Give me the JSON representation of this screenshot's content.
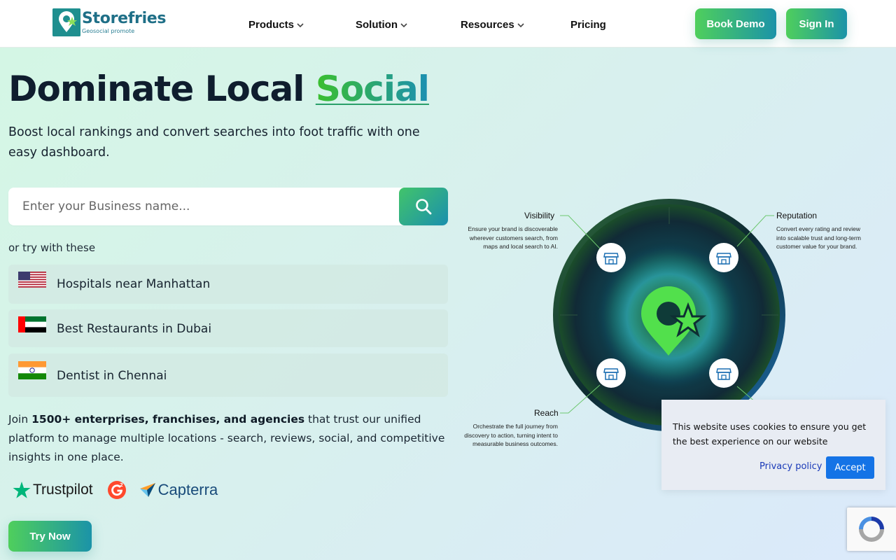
{
  "brand": {
    "name": "Storefries",
    "tagline": "Geosocial promote"
  },
  "nav": {
    "items": [
      {
        "label": "Products"
      },
      {
        "label": "Solution"
      },
      {
        "label": "Resources"
      },
      {
        "label": "Pricing"
      }
    ],
    "book_demo": "Book Demo",
    "sign_in": "Sign In"
  },
  "hero": {
    "title_main": "Dominate Local",
    "title_accent": "Social",
    "subtitle": "Boost local rankings and convert searches into foot traffic with one easy dashboard."
  },
  "search": {
    "placeholder": "Enter your Business name..."
  },
  "suggestions": {
    "label": "or try with these",
    "items": [
      {
        "label": "Hospitals near Manhattan",
        "flag": "us-flag"
      },
      {
        "label": "Best Restaurants in Dubai",
        "flag": "uae-flag"
      },
      {
        "label": "Dentist in Chennai",
        "flag": "india-flag"
      }
    ]
  },
  "join": {
    "prefix": "Join ",
    "bold": "1500+ enterprises, franchises, and agencies",
    "suffix": " that trust our unified platform to manage multiple locations - search, reviews, social, and competitive insights in one place."
  },
  "reviews": {
    "trustpilot": "Trustpilot",
    "capterra": "Capterra"
  },
  "try_now": "Try Now",
  "diagram": {
    "visibility": {
      "title": "Visibility",
      "desc": "Ensure your brand is discoverable wherever customers search, from maps and local search to AI."
    },
    "reputation": {
      "title": "Reputation",
      "desc": "Convert every rating and review into scalable trust and long-term customer value for your brand."
    },
    "reach": {
      "title": "Reach",
      "desc": "Orchestrate the full journey from discovery to action, turning intent to measurable business outcomes."
    }
  },
  "cookie": {
    "text": "This website uses cookies to ensure you get the best experience on our website",
    "privacy": "Privacy policy",
    "accept": "Accept"
  },
  "colors": {
    "accent_green": "#4fcf5c",
    "accent_teal": "#1b93a8",
    "accept_blue": "#1473e6"
  }
}
